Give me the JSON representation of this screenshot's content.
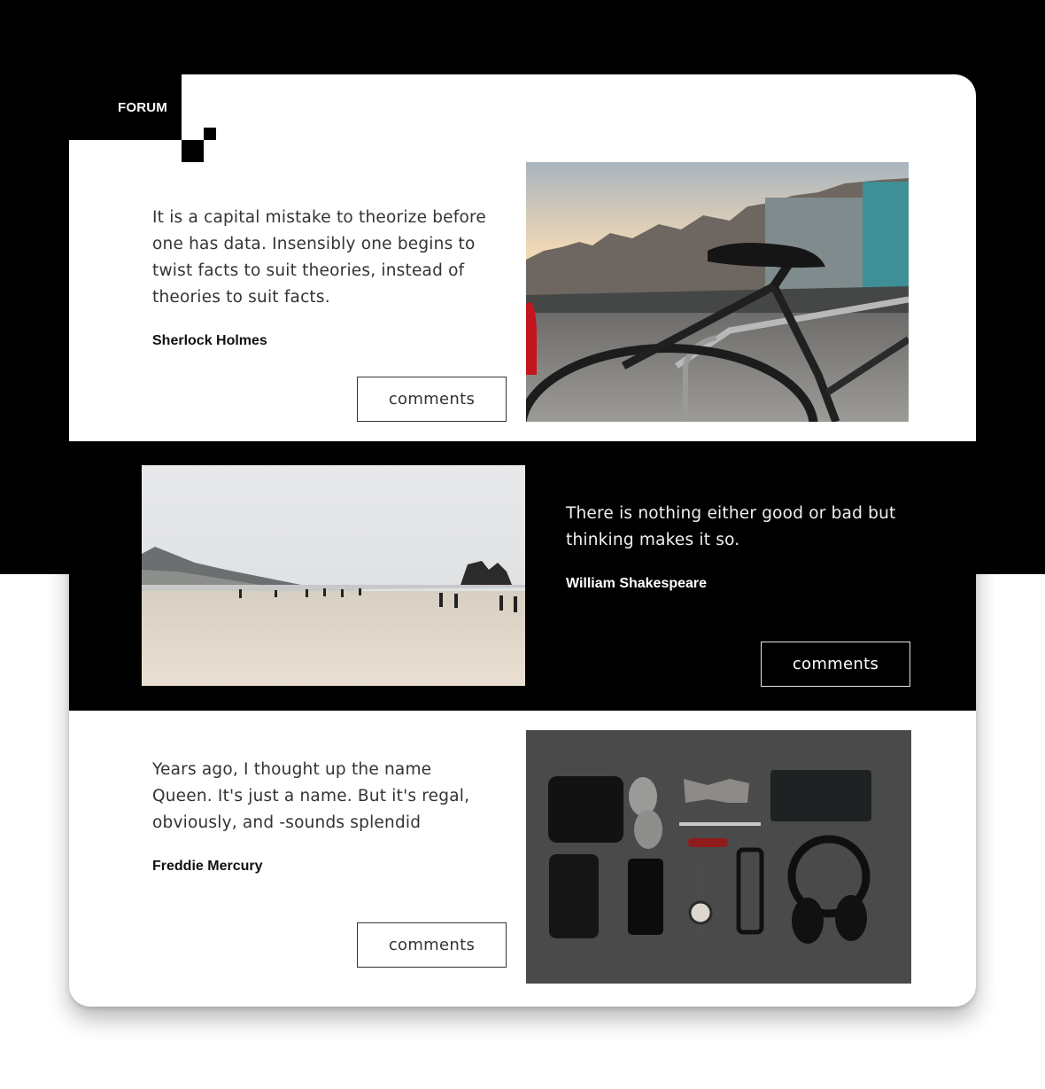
{
  "forum_label": "FORUM",
  "posts": [
    {
      "quote": "It is a capital mistake to theorize before\none has data. Insensibly one begins to\ntwist facts to suit theories, instead of\ntheories to suit facts.",
      "author": "Sherlock Holmes",
      "button": "comments",
      "image": "bicycle-photo"
    },
    {
      "quote": "There is nothing either good or bad but\nthinking makes it so.",
      "author": "William Shakespeare",
      "button": "comments",
      "image": "beach-photo"
    },
    {
      "quote": "Years ago, I thought up the name\nQueen. It's just a name. But it's regal,\nobviously, and -sounds splendid",
      "author": "Freddie Mercury",
      "button": "comments",
      "image": "flatlay-accessories-photo"
    }
  ],
  "colors": {
    "dark": "#000000",
    "light": "#ffffff",
    "text": "#333333"
  }
}
